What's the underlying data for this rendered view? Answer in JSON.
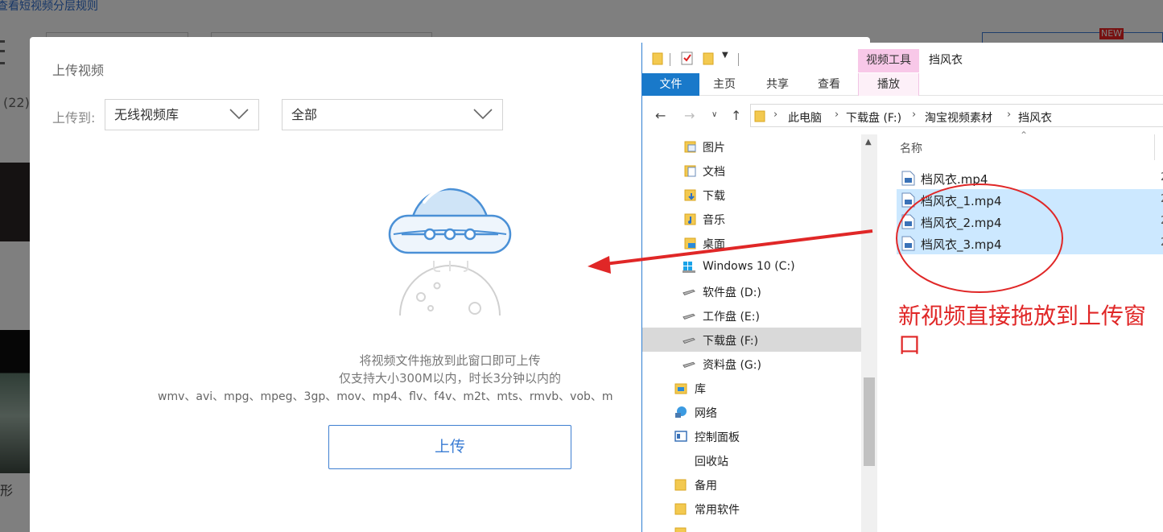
{
  "background": {
    "link_text": "查看短视频分层规则",
    "count_text": "(22)",
    "shape_text": "形",
    "new_badge": "NEW"
  },
  "dialog": {
    "title": "上传视频",
    "upload_to_label": "上传到:",
    "library_select": "无线视频库",
    "category_select": "全部",
    "hint_line1": "将视频文件拖放到此窗口即可上传",
    "hint_line2": "仅支持大小300M以内，时长3分钟以内的",
    "hint_formats": "wmv、avi、mpg、mpeg、3gp、mov、mp4、flv、f4v、m2t、mts、rmvb、vob、m",
    "upload_button": "上传"
  },
  "explorer": {
    "window_title": "挡风衣",
    "context_tab": "视频工具",
    "ribbon_tabs": {
      "file": "文件",
      "home": "主页",
      "share": "共享",
      "view": "查看",
      "play": "播放"
    },
    "breadcrumb": [
      "此电脑",
      "下载盘 (F:)",
      "淘宝视频素材",
      "挡风衣"
    ],
    "nav_items": [
      {
        "label": "图片",
        "icon": "pictures-folder-icon"
      },
      {
        "label": "文档",
        "icon": "documents-folder-icon"
      },
      {
        "label": "下载",
        "icon": "downloads-folder-icon"
      },
      {
        "label": "音乐",
        "icon": "music-folder-icon"
      },
      {
        "label": "桌面",
        "icon": "desktop-folder-icon"
      },
      {
        "label": "Windows 10 (C:)",
        "icon": "windows-drive-icon"
      },
      {
        "label": "软件盘 (D:)",
        "icon": "drive-icon"
      },
      {
        "label": "工作盘 (E:)",
        "icon": "drive-icon"
      },
      {
        "label": "下载盘 (F:)",
        "icon": "drive-icon",
        "selected": true
      },
      {
        "label": "资料盘 (G:)",
        "icon": "drive-icon"
      },
      {
        "label": "库",
        "icon": "library-icon"
      },
      {
        "label": "网络",
        "icon": "network-icon"
      },
      {
        "label": "控制面板",
        "icon": "control-panel-icon"
      },
      {
        "label": "回收站",
        "icon": "recycle-bin-icon"
      },
      {
        "label": "备用",
        "icon": "folder-icon"
      },
      {
        "label": "常用软件",
        "icon": "folder-icon"
      }
    ],
    "column_name": "名称",
    "files": [
      {
        "name": "档风衣.mp4",
        "selected": false
      },
      {
        "name": "档风衣_1.mp4",
        "selected": true
      },
      {
        "name": "档风衣_2.mp4",
        "selected": true
      },
      {
        "name": "档风衣_3.mp4",
        "selected": true
      }
    ],
    "annotation": "新视频直接拖放到上传窗口"
  },
  "colors": {
    "accent_blue": "#1979ca",
    "selection": "#cce8ff",
    "annotation_red": "#e02727",
    "context_pink": "#f8c8e8"
  }
}
